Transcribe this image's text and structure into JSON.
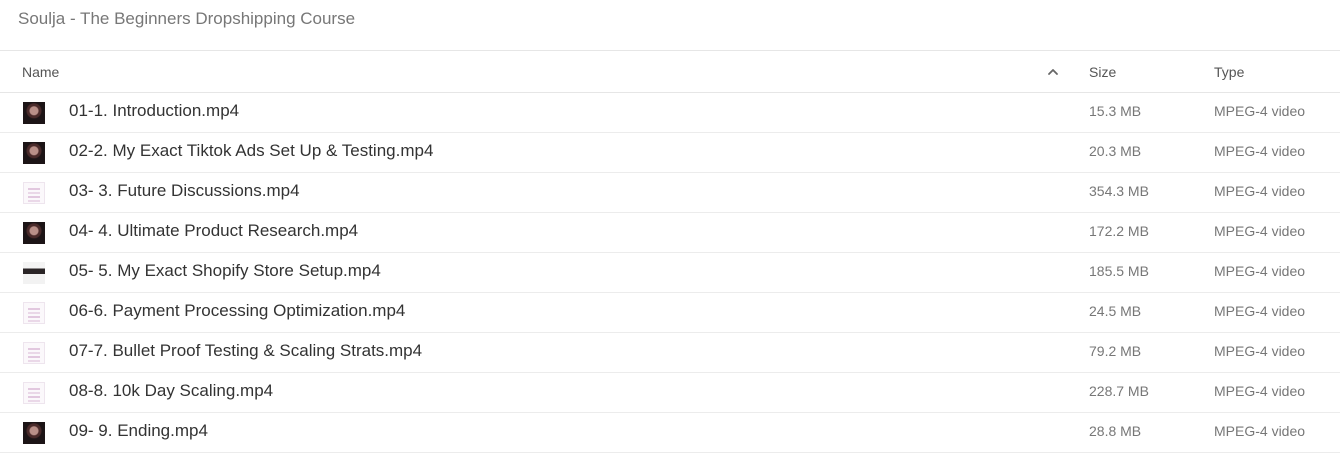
{
  "breadcrumb": "Soulja - The Beginners Dropshipping Course",
  "columns": {
    "name": "Name",
    "size": "Size",
    "type": "Type",
    "sort_icon": "chevron-up-icon"
  },
  "files": [
    {
      "name": "01-1. Introduction.mp4",
      "size": "15.3 MB",
      "type": "MPEG-4 video",
      "thumb": "dark"
    },
    {
      "name": "02-2. My Exact Tiktok Ads Set Up & Testing.mp4",
      "size": "20.3 MB",
      "type": "MPEG-4 video",
      "thumb": "dark"
    },
    {
      "name": "03- 3. Future Discussions.mp4",
      "size": "354.3 MB",
      "type": "MPEG-4 video",
      "thumb": "doc"
    },
    {
      "name": "04- 4. Ultimate Product Research.mp4",
      "size": "172.2 MB",
      "type": "MPEG-4 video",
      "thumb": "dark"
    },
    {
      "name": "05- 5. My Exact Shopify Store Setup.mp4",
      "size": "185.5 MB",
      "type": "MPEG-4 video",
      "thumb": "mixed"
    },
    {
      "name": "06-6. Payment Processing Optimization.mp4",
      "size": "24.5 MB",
      "type": "MPEG-4 video",
      "thumb": "doc"
    },
    {
      "name": "07-7. Bullet Proof Testing & Scaling Strats.mp4",
      "size": "79.2 MB",
      "type": "MPEG-4 video",
      "thumb": "doc"
    },
    {
      "name": "08-8. 10k Day Scaling.mp4",
      "size": "228.7 MB",
      "type": "MPEG-4 video",
      "thumb": "doc"
    },
    {
      "name": "09- 9. Ending.mp4",
      "size": "28.8 MB",
      "type": "MPEG-4 video",
      "thumb": "dark"
    }
  ]
}
